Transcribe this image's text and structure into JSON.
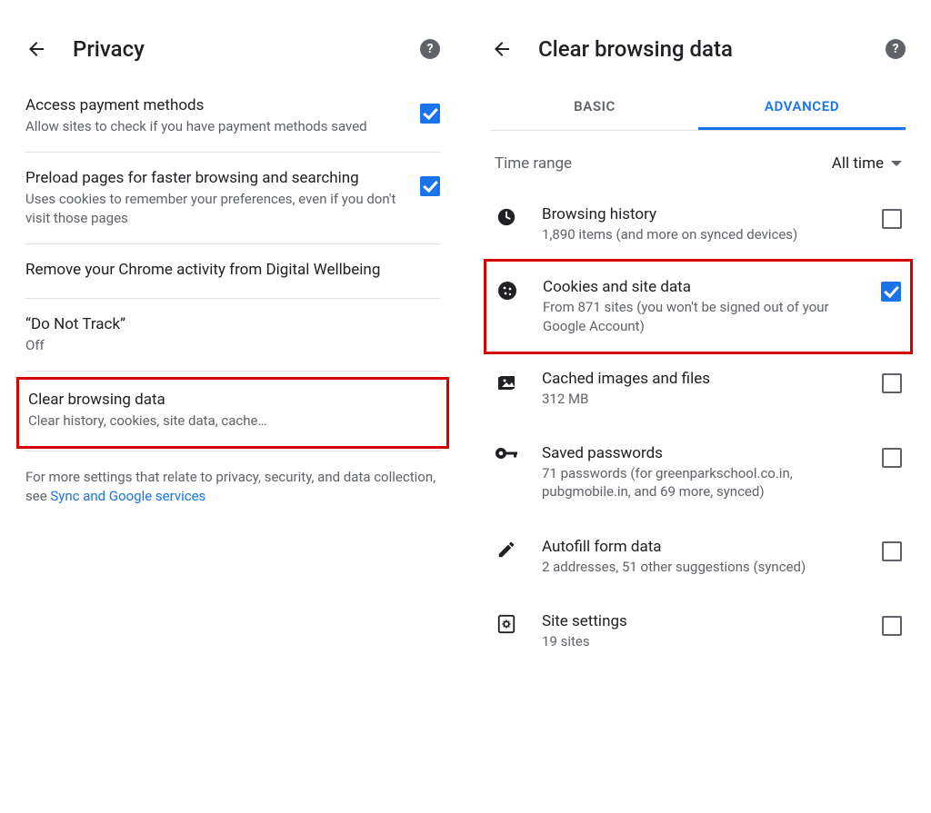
{
  "left": {
    "title": "Privacy",
    "items": [
      {
        "title": "Access payment methods",
        "sub": "Allow sites to check if you have payment methods saved",
        "checked": true
      },
      {
        "title": "Preload pages for faster browsing and searching",
        "sub": "Uses cookies to remember your preferences, even if you don't visit those pages",
        "checked": true
      },
      {
        "title": "Remove your Chrome activity from Digital Wellbeing",
        "sub": ""
      },
      {
        "title": "“Do Not Track”",
        "sub": "Off"
      },
      {
        "title": "Clear browsing data",
        "sub": "Clear history, cookies, site data, cache…"
      }
    ],
    "footer_pre": "For more settings that relate to privacy, security, and data collection, see ",
    "footer_link": "Sync and Google services"
  },
  "right": {
    "title": "Clear browsing data",
    "tabs": {
      "basic": "BASIC",
      "advanced": "ADVANCED"
    },
    "time_range_label": "Time range",
    "time_range_value": "All time",
    "items": [
      {
        "title": "Browsing history",
        "sub": "1,890 items (and more on synced devices)",
        "checked": false
      },
      {
        "title": "Cookies and site data",
        "sub": "From 871 sites (you won't be signed out of your Google Account)",
        "checked": true,
        "highlight": true
      },
      {
        "title": "Cached images and files",
        "sub": "312 MB",
        "checked": false
      },
      {
        "title": "Saved passwords",
        "sub": "71 passwords (for greenparkschool.co.in, pubgmobile.in, and 69 more, synced)",
        "checked": false
      },
      {
        "title": "Autofill form data",
        "sub": "2 addresses, 51 other suggestions (synced)",
        "checked": false
      },
      {
        "title": "Site settings",
        "sub": "19 sites",
        "checked": false
      }
    ]
  }
}
